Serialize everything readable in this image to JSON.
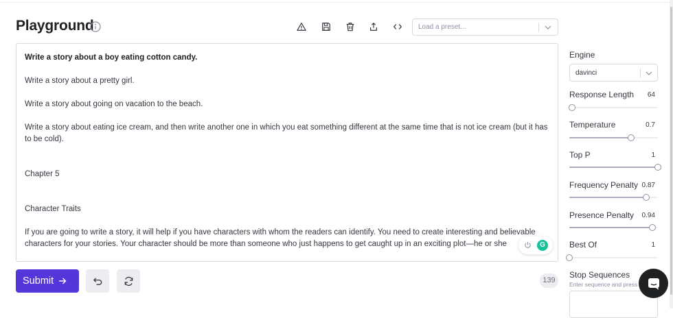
{
  "header": {
    "title": "Playground"
  },
  "toolbar": {
    "icons": [
      "warning-icon",
      "save-icon",
      "trash-icon",
      "share-icon",
      "code-icon"
    ],
    "preset_placeholder": "Load a preset..."
  },
  "editor": {
    "paragraphs": [
      "Write a story about a boy eating cotton candy.",
      "Write a story about a pretty girl.",
      "Write a story about going on vacation to the beach.",
      "Write a story about eating ice cream, and then write another one in which you eat something different at the same time that is not ice cream (but it has to be cold).",
      "Chapter 5",
      "Character Traits",
      "If you are going to write a story, it will help if you have characters with whom the readers can identify. You need to create interesting and believable characters for your stories. Your character should be more than someone who just happens to get caught up in an exciting plot—he or she"
    ],
    "grammarly_letter": "G"
  },
  "actions": {
    "submit_label": "Submit",
    "token_count": "139"
  },
  "settings": {
    "engine_label": "Engine",
    "engine_value": "davinci",
    "sliders": [
      {
        "label": "Response Length",
        "value": "64",
        "fraction": 0.03
      },
      {
        "label": "Temperature",
        "value": "0.7",
        "fraction": 0.7
      },
      {
        "label": "Top P",
        "value": "1",
        "fraction": 1.0
      },
      {
        "label": "Frequency Penalty",
        "value": "0.87",
        "fraction": 0.87
      },
      {
        "label": "Presence Penalty",
        "value": "0.94",
        "fraction": 0.94
      },
      {
        "label": "Best Of",
        "value": "1",
        "fraction": 0.0
      }
    ],
    "stop_label": "Stop Sequences",
    "stop_placeholder": "Enter sequence and press Tab"
  },
  "colors": {
    "accent": "#5436da",
    "grammarly": "#15c39a"
  }
}
